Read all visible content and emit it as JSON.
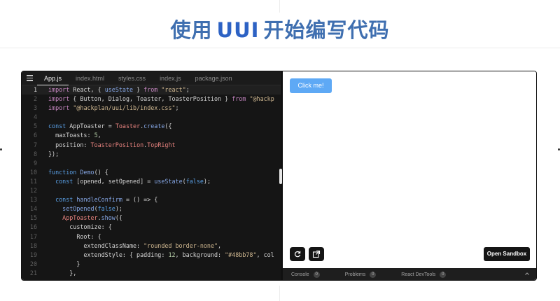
{
  "headline": {
    "before": "使用",
    "brand": "UUI",
    "after": "开始编写代码",
    "color": "#3f6fb0"
  },
  "editor": {
    "tabs": [
      {
        "label": "App.js",
        "active": true
      },
      {
        "label": "index.html",
        "active": false
      },
      {
        "label": "styles.css",
        "active": false
      },
      {
        "label": "index.js",
        "active": false
      },
      {
        "label": "package.json",
        "active": false
      }
    ],
    "highlighted_line": 1,
    "code_lines": [
      [
        [
          "import",
          "k"
        ],
        [
          " React, { ",
          "p"
        ],
        [
          "useState",
          "f"
        ],
        [
          " } ",
          "p"
        ],
        [
          "from",
          "k"
        ],
        [
          " ",
          "p"
        ],
        [
          "\"react\"",
          "s"
        ],
        [
          ";",
          "p"
        ]
      ],
      [
        [
          "import",
          "k"
        ],
        [
          " { Button, Dialog, Toaster, ToasterPosition } ",
          "p"
        ],
        [
          "from",
          "k"
        ],
        [
          " ",
          "p"
        ],
        [
          "\"@hackp",
          "s"
        ]
      ],
      [
        [
          "import",
          "k"
        ],
        [
          " ",
          "p"
        ],
        [
          "\"@hackplan/uui/lib/index.css\"",
          "s"
        ],
        [
          ";",
          "p"
        ]
      ],
      [],
      [
        [
          "const",
          "b"
        ],
        [
          " AppToaster = ",
          "p"
        ],
        [
          "Toaster",
          "r"
        ],
        [
          ".",
          "p"
        ],
        [
          "create",
          "f"
        ],
        [
          "({",
          "p"
        ]
      ],
      [
        [
          "  maxToasts: ",
          "p"
        ],
        [
          "5",
          "n"
        ],
        [
          ",",
          "p"
        ]
      ],
      [
        [
          "  position: ",
          "p"
        ],
        [
          "ToasterPosition",
          "r"
        ],
        [
          ".",
          "p"
        ],
        [
          "TopRight",
          "r"
        ]
      ],
      [
        [
          "});",
          "p"
        ]
      ],
      [],
      [
        [
          "function",
          "b"
        ],
        [
          " ",
          "p"
        ],
        [
          "Demo",
          "f"
        ],
        [
          "() {",
          "p"
        ]
      ],
      [
        [
          "  ",
          "p"
        ],
        [
          "const",
          "b"
        ],
        [
          " [opened, setOpened] = ",
          "p"
        ],
        [
          "useState",
          "f"
        ],
        [
          "(",
          "p"
        ],
        [
          "false",
          "b"
        ],
        [
          ");",
          "p"
        ]
      ],
      [],
      [
        [
          "  ",
          "p"
        ],
        [
          "const",
          "b"
        ],
        [
          " ",
          "p"
        ],
        [
          "handleConfirm",
          "f"
        ],
        [
          " = () => {",
          "p"
        ]
      ],
      [
        [
          "    ",
          "p"
        ],
        [
          "setOpened",
          "f"
        ],
        [
          "(",
          "p"
        ],
        [
          "false",
          "b"
        ],
        [
          ");",
          "p"
        ]
      ],
      [
        [
          "    ",
          "p"
        ],
        [
          "AppToaster",
          "r"
        ],
        [
          ".",
          "p"
        ],
        [
          "show",
          "f"
        ],
        [
          "({",
          "p"
        ]
      ],
      [
        [
          "      customize: {",
          "p"
        ]
      ],
      [
        [
          "        Root: {",
          "p"
        ]
      ],
      [
        [
          "          extendClassName: ",
          "p"
        ],
        [
          "\"rounded border-none\"",
          "s"
        ],
        [
          ",",
          "p"
        ]
      ],
      [
        [
          "          extendStyle: { padding: ",
          "p"
        ],
        [
          "12",
          "n"
        ],
        [
          ", background: ",
          "p"
        ],
        [
          "\"#48bb78\"",
          "s"
        ],
        [
          ", col",
          "p"
        ]
      ],
      [
        [
          "        }",
          "p"
        ]
      ],
      [
        [
          "      },",
          "p"
        ]
      ]
    ]
  },
  "preview": {
    "click_button": "Click me!",
    "refresh_icon": "refresh-icon",
    "new_window_icon": "open-new-window-icon",
    "open_sandbox": "Open Sandbox",
    "accent": "#5ea9f5"
  },
  "console": {
    "tabs": [
      {
        "label": "Console",
        "count": "0"
      },
      {
        "label": "Problems",
        "count": "0"
      },
      {
        "label": "React DevTools",
        "count": "0"
      }
    ],
    "collapse_icon": "chevron-up-icon"
  }
}
